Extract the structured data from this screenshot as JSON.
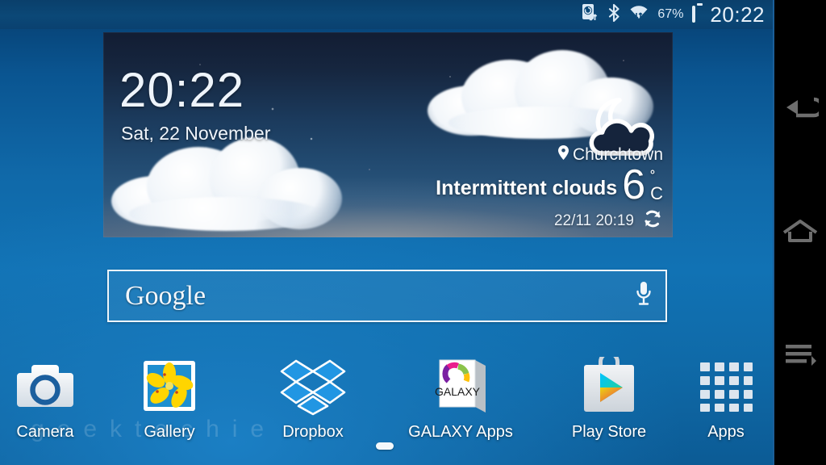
{
  "status_bar": {
    "icons": [
      "sync-icon",
      "bluetooth-icon",
      "wifi-icon",
      "battery-icon"
    ],
    "battery_percent": "67%",
    "clock": "20:22"
  },
  "weather_widget": {
    "clock": "20:22",
    "date": "Sat, 22 November",
    "location": "Churchtown",
    "condition": "Intermittent clouds",
    "temperature": "6",
    "degree_symbol": "˚",
    "unit": "C",
    "updated": "22/11 20:19",
    "weather_icon": "moon-behind-cloud-icon",
    "refresh_icon": "refresh-icon",
    "location_icon": "location-pin-icon"
  },
  "search": {
    "logo_text": "Google",
    "placeholder": "Google",
    "mic_icon": "microphone-icon"
  },
  "apps": [
    {
      "label": "Camera",
      "icon": "camera-icon"
    },
    {
      "label": "Gallery",
      "icon": "gallery-icon"
    },
    {
      "label": "Dropbox",
      "icon": "dropbox-icon"
    },
    {
      "label": "GALAXY Apps",
      "icon": "galaxy-apps-icon",
      "badge_text": "GALAXY"
    },
    {
      "label": "Play Store",
      "icon": "play-store-icon"
    },
    {
      "label": "Apps",
      "icon": "apps-grid-icon"
    }
  ],
  "watermark": "geektechie",
  "nav_bar": {
    "back_label": "Back",
    "home_label": "Home",
    "recents_label": "Recent apps",
    "icons": [
      "back-icon",
      "home-icon",
      "recent-apps-icon"
    ]
  },
  "colors": {
    "wallpaper_blue": "#1172b4",
    "status_bar_blue": "#0b4877",
    "battery_green": "#6cc04a",
    "accent_white": "#ffffff",
    "nav_icon_gray": "#6e6e6e"
  }
}
